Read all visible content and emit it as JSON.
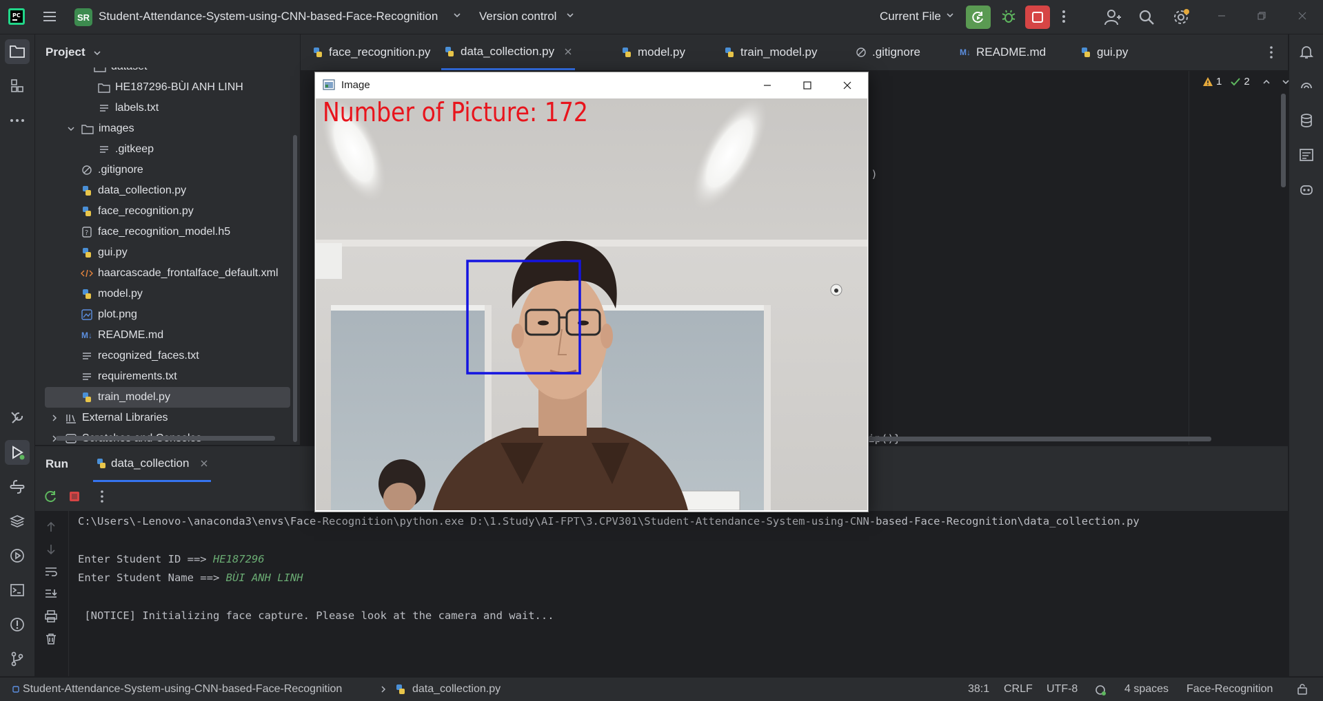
{
  "titlebar": {
    "project_badge": "SR",
    "project_name": "Student-Attendance-System-using-CNN-based-Face-Recognition",
    "version_control": "Version control",
    "run_config": "Current File"
  },
  "project_panel": {
    "title": "Project",
    "items": [
      {
        "label": "dataset",
        "type": "folder"
      },
      {
        "label": "HE187296-BÙI ANH LINH",
        "type": "folder"
      },
      {
        "label": "labels.txt",
        "type": "text"
      },
      {
        "label": "images",
        "type": "folder"
      },
      {
        "label": ".gitkeep",
        "type": "text"
      },
      {
        "label": ".gitignore",
        "type": "ignore"
      },
      {
        "label": "data_collection.py",
        "type": "python"
      },
      {
        "label": "face_recognition.py",
        "type": "python"
      },
      {
        "label": "face_recognition_model.h5",
        "type": "unknown"
      },
      {
        "label": "gui.py",
        "type": "python"
      },
      {
        "label": "haarcascade_frontalface_default.xml",
        "type": "xml"
      },
      {
        "label": "model.py",
        "type": "python"
      },
      {
        "label": "plot.png",
        "type": "image"
      },
      {
        "label": "README.md",
        "type": "markdown"
      },
      {
        "label": "recognized_faces.txt",
        "type": "text"
      },
      {
        "label": "requirements.txt",
        "type": "text"
      },
      {
        "label": "train_model.py",
        "type": "python"
      },
      {
        "label": "External Libraries",
        "type": "library"
      },
      {
        "label": "Scratches and Consoles",
        "type": "scratch"
      }
    ]
  },
  "editor": {
    "tabs": [
      {
        "label": "face_recognition.py"
      },
      {
        "label": "data_collection.py",
        "active": true
      },
      {
        "label": "model.py"
      },
      {
        "label": "train_model.py"
      },
      {
        "label": ".gitignore"
      },
      {
        "label": "README.md"
      },
      {
        "label": "gui.py"
      }
    ],
    "warnings": "1",
    "checks": "2",
    "code_fragment_1": "')",
    "code_fragment_2": "e",
    "code_fragment_3": "rip()}"
  },
  "image_window": {
    "title": "Image",
    "overlay_text": "Number of Picture: 172"
  },
  "run_panel": {
    "label": "Run",
    "tab": "data_collection",
    "console": {
      "command": "C:\\Users\\-Lenovo-\\anaconda3\\envs\\Face-Recognition\\python.exe D:\\1.Study\\AI-FPT\\3.CPV301\\Student-Attendance-System-using-CNN-based-Face-Recognition\\data_collection.py",
      "prompt_id": "Enter Student ID ==> ",
      "input_id": "HE187296",
      "prompt_name": "Enter Student Name ==> ",
      "input_name": "BÙI ANH LINH",
      "notice": " [NOTICE] Initializing face capture. Please look at the camera and wait..."
    }
  },
  "statusbar": {
    "project": "Student-Attendance-System-using-CNN-based-Face-Recognition",
    "file": "data_collection.py",
    "position": "38:1",
    "line_sep": "CRLF",
    "encoding": "UTF-8",
    "indent": "4 spaces",
    "interpreter": "Face-Recognition"
  },
  "colors": {
    "accent": "#3574f0",
    "badge": "#3d8b4f",
    "run_green": "#5a9a52",
    "stop_red": "#d64545",
    "overlay_red": "#e8141c",
    "face_box": "#1414e0"
  }
}
